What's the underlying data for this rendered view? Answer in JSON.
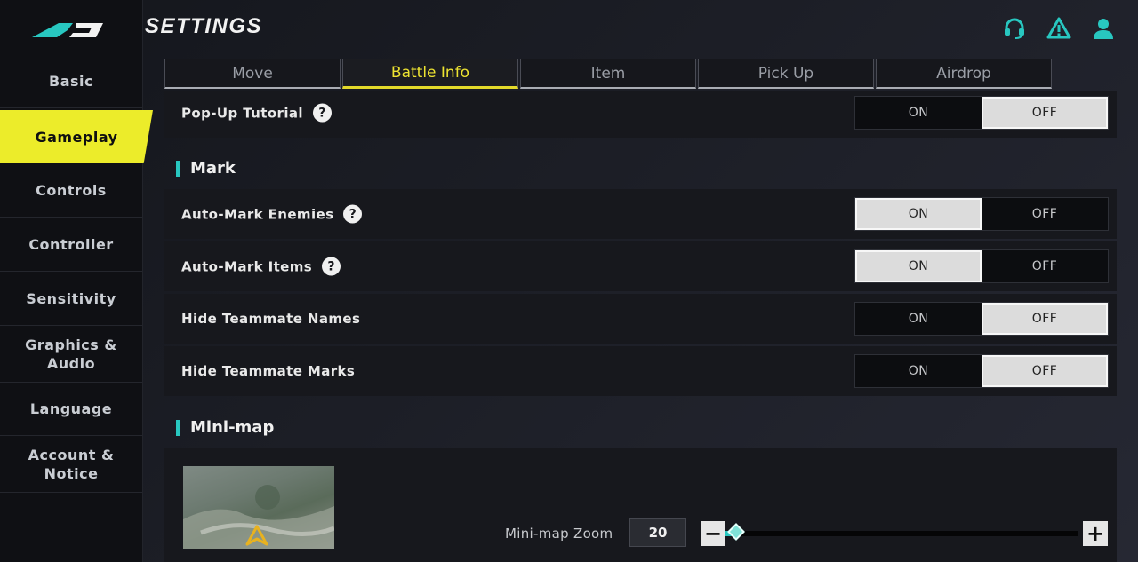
{
  "header": {
    "title": "SETTINGS"
  },
  "top_icons": [
    "headset-icon",
    "warning-icon",
    "user-icon"
  ],
  "sidebar": {
    "items": [
      {
        "label": "Basic",
        "active": false
      },
      {
        "label": "Gameplay",
        "active": true
      },
      {
        "label": "Controls",
        "active": false
      },
      {
        "label": "Controller",
        "active": false
      },
      {
        "label": "Sensitivity",
        "active": false
      },
      {
        "label": "Graphics &\nAudio",
        "active": false
      },
      {
        "label": "Language",
        "active": false
      },
      {
        "label": "Account &\nNotice",
        "active": false
      }
    ]
  },
  "tabs": [
    {
      "label": "Move",
      "active": false
    },
    {
      "label": "Battle Info",
      "active": true
    },
    {
      "label": "Item",
      "active": false
    },
    {
      "label": "Pick Up",
      "active": false
    },
    {
      "label": "Airdrop",
      "active": false
    }
  ],
  "toggle_labels": {
    "on": "ON",
    "off": "OFF"
  },
  "rows": [
    {
      "label": "Pop-Up Tutorial",
      "help": "?",
      "value": "OFF"
    },
    {
      "label": "Auto-Mark Enemies",
      "help": "?",
      "value": "ON"
    },
    {
      "label": "Auto-Mark Items",
      "help": "?",
      "value": "ON"
    },
    {
      "label": "Hide Teammate Names",
      "value": "OFF"
    },
    {
      "label": "Hide Teammate Marks",
      "value": "OFF"
    }
  ],
  "sections": {
    "mark": "Mark",
    "minimap": "Mini-map"
  },
  "minimap": {
    "zoom_label": "Mini-map Zoom",
    "zoom_value": "20",
    "minus": "−",
    "plus": "+",
    "slider_fraction": 0.03
  },
  "colors": {
    "accent_yellow": "#ecec2a",
    "accent_teal": "#28c7c0"
  }
}
